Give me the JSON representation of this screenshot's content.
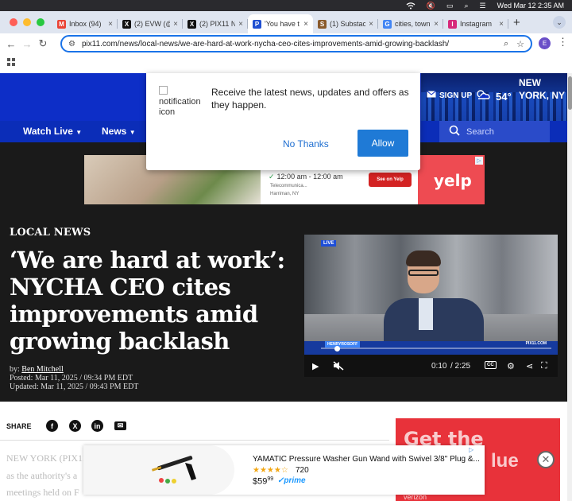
{
  "menubar": {
    "datetime": "Wed Mar 12  2:35 AM"
  },
  "tabs": [
    {
      "label": "Inbox (94)",
      "favicon": "gmail-icon",
      "color": "#ea4335",
      "glyph": "M"
    },
    {
      "label": "(2) EVW (@",
      "favicon": "x-icon",
      "color": "#111111",
      "glyph": "X"
    },
    {
      "label": "(2) PIX11 N",
      "favicon": "x-icon",
      "color": "#111111",
      "glyph": "X"
    },
    {
      "label": "'You have t",
      "favicon": "pix11-icon",
      "color": "#1f4fd1",
      "glyph": "P",
      "active": true
    },
    {
      "label": "(1) Substac",
      "favicon": "substack-icon",
      "color": "#8a5a2b",
      "glyph": "S"
    },
    {
      "label": "cities, town",
      "favicon": "google-icon",
      "color": "#4285f4",
      "glyph": "G"
    },
    {
      "label": "Instagram",
      "favicon": "instagram-icon",
      "color": "#d6297a",
      "glyph": "I"
    }
  ],
  "address": {
    "url": "pix11.com/news/local-news/we-are-hard-at-work-nycha-ceo-cites-improvements-amid-growing-backlash/"
  },
  "profile": {
    "initial": "E"
  },
  "header": {
    "signup": "SIGN UP",
    "temperature": "54°",
    "location": "NEW YORK, NY"
  },
  "nav": {
    "items": [
      "Watch Live",
      "News"
    ],
    "search_placeholder": "Search"
  },
  "popup": {
    "icon_alt": "notification icon",
    "message": "Receive the latest news, updates and offers as they happen.",
    "no_thanks": "No Thanks",
    "allow": "Allow"
  },
  "ad_top": {
    "hours": "12:00 am - 12:00 am",
    "line1": "Telecommunica...",
    "line2": "Harriman, NY",
    "cta": "See on Yelp",
    "brand": "yelp"
  },
  "article": {
    "kicker": "LOCAL NEWS",
    "headline": "‘We are hard at work’: NYCHA CEO cites improvements amid growing backlash",
    "byline_prefix": "by: ",
    "author": "Ben Mitchell",
    "posted": "Posted: Mar 11, 2025 / 09:34 PM EDT",
    "updated": "Updated: Mar 11, 2025 / 09:43 PM EDT",
    "share_label": "SHARE",
    "body": [
      "NEW YORK (PIX11) —",
      "as the authority's a",
      "meetings held on F"
    ]
  },
  "video": {
    "live_badge": "LIVE",
    "lower_tag": "HENRYROSOFF",
    "brand": "PIX11.COM",
    "current_time": "0:10",
    "duration": "/ 2:25",
    "progress": 0.07
  },
  "side_ad": {
    "big1": "Get the",
    "big2": "lue",
    "brand": "verizon"
  },
  "bottom_ad": {
    "title": "YAMATIC Pressure Washer Gun Wand with Swivel 3/8\" Plug &...",
    "stars": "★★★★☆",
    "rating_count": "720",
    "price_whole": "$59",
    "price_cents": "99",
    "prime": "✓prime"
  },
  "colors": {
    "header_blue": "#0d2ec7",
    "accent": "#1f7ad6"
  }
}
